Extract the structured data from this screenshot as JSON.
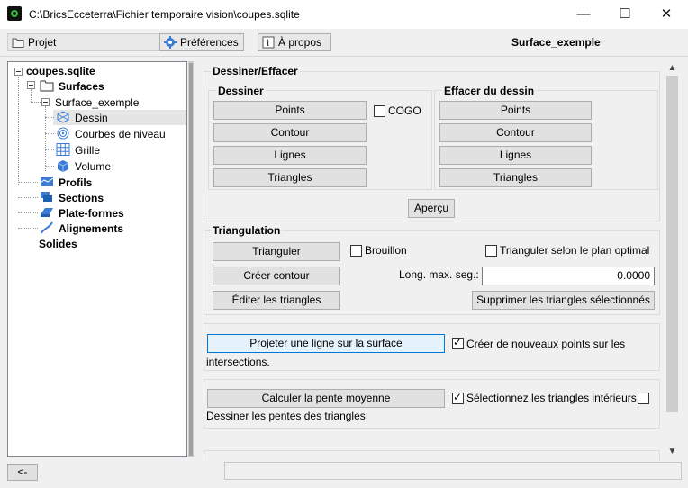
{
  "window": {
    "title": "C:\\BricsEcceterra\\Fichier temporaire vision\\coupes.sqlite",
    "minimize": "—",
    "maximize": "☐",
    "close": "✕"
  },
  "toolbar": {
    "projet_label": "Projet",
    "preferences_label": "Préférences",
    "apropos_label": "À propos",
    "surface_title": "Surface_exemple"
  },
  "tree": {
    "root": "coupes.sqlite",
    "surfaces": "Surfaces",
    "surface_exemple": "Surface_exemple",
    "dessin": "Dessin",
    "courbes": "Courbes de niveau",
    "grille": "Grille",
    "volume": "Volume",
    "profils": "Profils",
    "sections": "Sections",
    "plateformes": "Plate-formes",
    "alignements": "Alignements",
    "solides": "Solides"
  },
  "dessiner_effacer": {
    "title": "Dessiner/Effacer",
    "dessiner": {
      "title": "Dessiner",
      "buttons": [
        "Points",
        "Contour",
        "Lignes",
        "Triangles"
      ],
      "cogo_label": "COGO"
    },
    "effacer": {
      "title": "Effacer du dessin",
      "buttons": [
        "Points",
        "Contour",
        "Lignes",
        "Triangles"
      ]
    },
    "apercu": "Aperçu"
  },
  "triangulation": {
    "title": "Triangulation",
    "trianguler": "Trianguler",
    "brouillon": "Brouillon",
    "plan_optimal": "Trianguler selon le plan optimal",
    "creer_contour": "Créer contour",
    "long_max_label": "Long. max. seg.:",
    "long_max_value": "0.0000",
    "editer": "Éditer les triangles",
    "supprimer": "Supprimer les triangles sélectionnés"
  },
  "projeter": {
    "button": "Projeter une ligne sur la surface",
    "checkbox_label": "Créer de nouveaux points sur les",
    "checkbox_label_cont": "intersections.",
    "checked": true
  },
  "pente": {
    "button": "Calculer la pente moyenne",
    "checkbox_label": "Sélectionnez les triangles intérieurs",
    "checked": true,
    "note": "Dessiner les pentes des triangles"
  },
  "bottom": {
    "back": "<-"
  }
}
